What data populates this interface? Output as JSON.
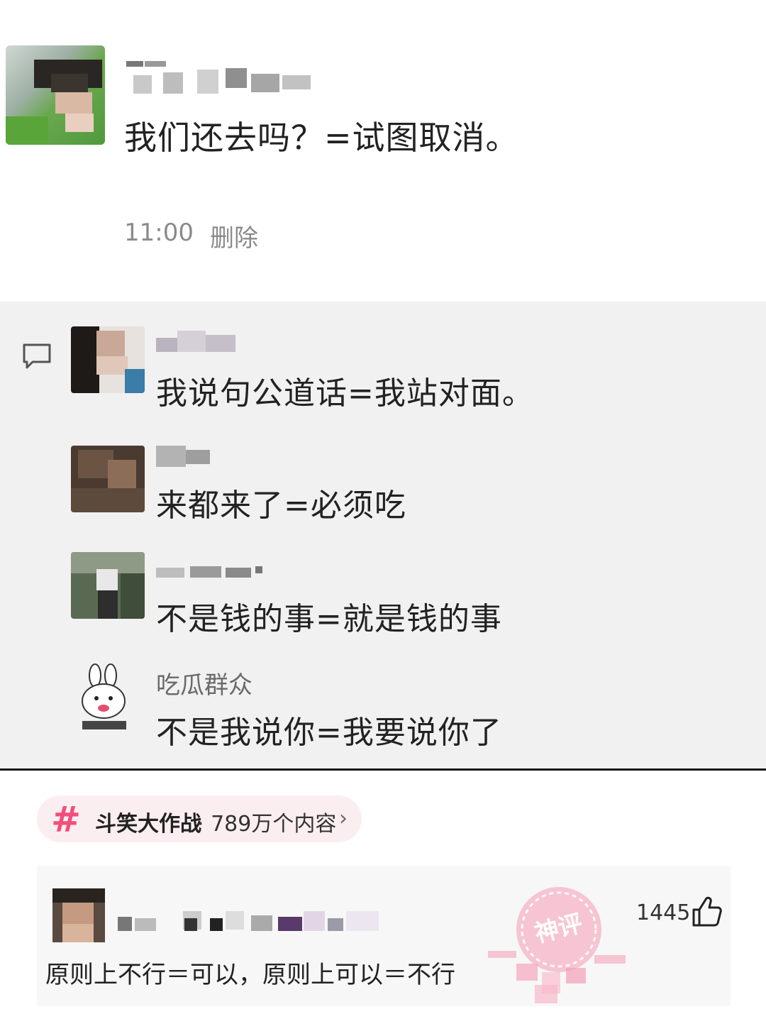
{
  "post": {
    "text": "我们还去吗？=试图取消。",
    "time": "11:00",
    "delete_label": "删除"
  },
  "comments": [
    {
      "text": "我说句公道话=我站对面。"
    },
    {
      "text": "来都来了=必须吃"
    },
    {
      "text": "不是钱的事=就是钱的事"
    },
    {
      "name": "吃瓜群众",
      "text": "不是我说你=我要说你了"
    }
  ],
  "topic": {
    "hash": "#",
    "name": "斗笑大作战",
    "count": "· 789万个内容",
    "chevron": "›"
  },
  "reply": {
    "text": "原则上不行＝可以，原则上可以＝不行",
    "likes": "1445"
  },
  "stamp": {
    "label": "神评"
  },
  "icons": {
    "comment": "comment-bubble-icon",
    "like": "thumbs-up-icon",
    "chevron": "chevron-right-icon"
  },
  "colors": {
    "accent": "#f0507a",
    "panel": "#f1f1f1",
    "stamp": "#f08aa6"
  }
}
